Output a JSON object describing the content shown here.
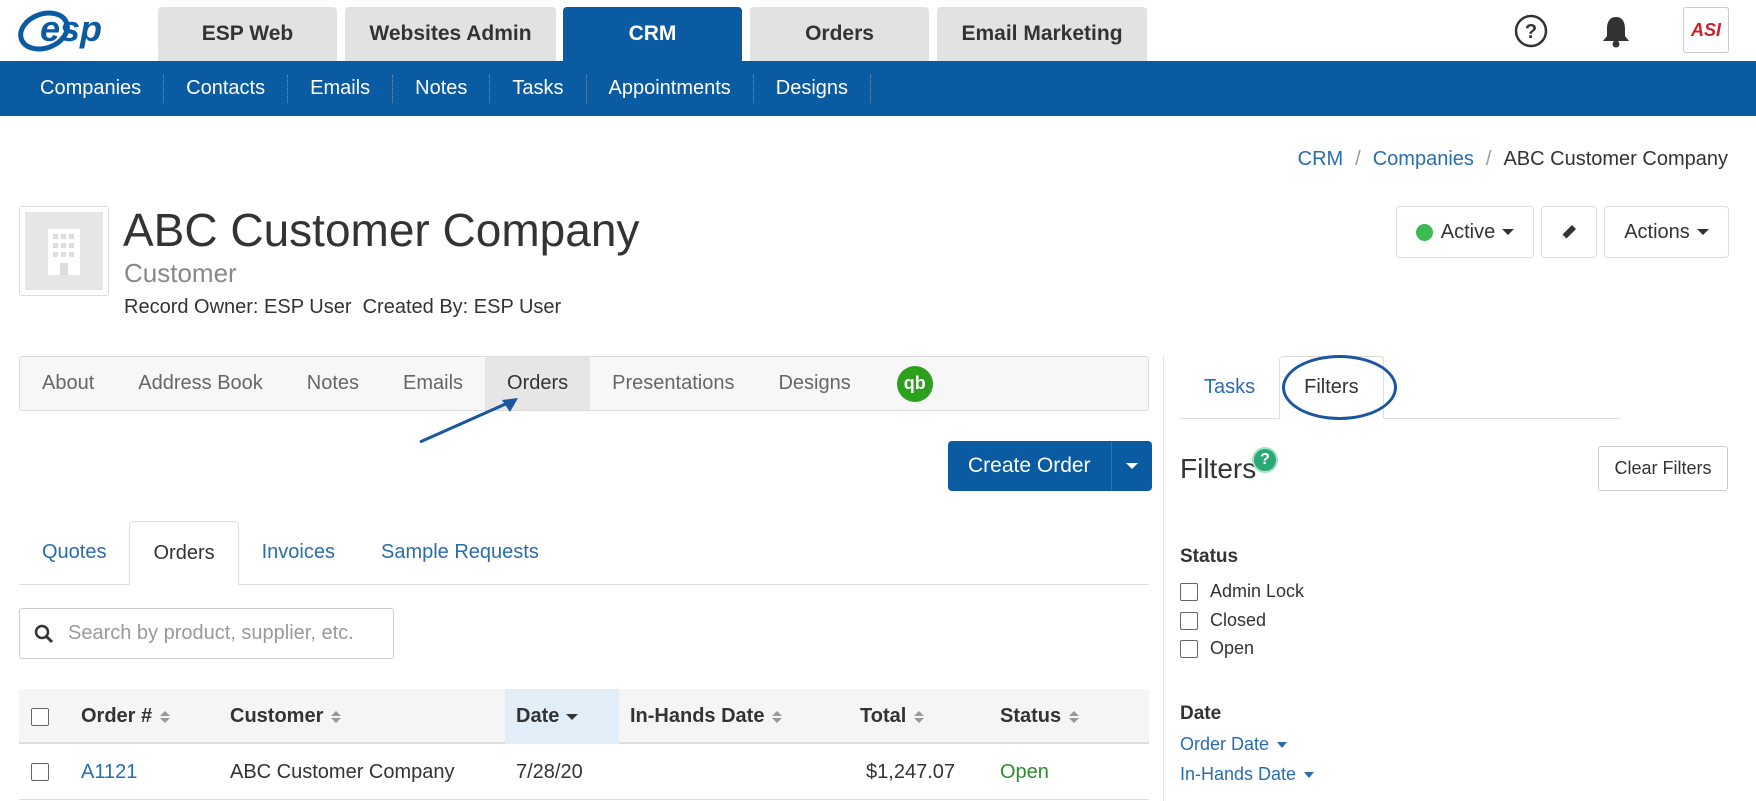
{
  "brand": {
    "logo_text": "esp",
    "accent": "#0a5ba1"
  },
  "app_tabs": [
    {
      "label": "ESP Web",
      "active": false
    },
    {
      "label": "Websites Admin",
      "active": false
    },
    {
      "label": "CRM",
      "active": true
    },
    {
      "label": "Orders",
      "active": false
    },
    {
      "label": "Email Marketing",
      "active": false
    }
  ],
  "top_icons": {
    "help": "help-circle-icon",
    "notifications": "bell-icon",
    "avatar_text": "asi"
  },
  "subnav": [
    "Companies",
    "Contacts",
    "Emails",
    "Notes",
    "Tasks",
    "Appointments",
    "Designs"
  ],
  "breadcrumb": {
    "crm": "CRM",
    "companies": "Companies",
    "current": "ABC Customer Company",
    "sep": "/"
  },
  "company": {
    "name": "ABC Customer Company",
    "type": "Customer",
    "record_info": "Record Owner: ESP User  Created By: ESP User"
  },
  "header_buttons": {
    "status": "Active",
    "status_color": "#3cba54",
    "edit_icon": "pencil-icon",
    "actions": "Actions"
  },
  "record_tabs": [
    {
      "label": "About",
      "active": false
    },
    {
      "label": "Address Book",
      "active": false
    },
    {
      "label": "Notes",
      "active": false
    },
    {
      "label": "Emails",
      "active": false
    },
    {
      "label": "Orders",
      "active": true
    },
    {
      "label": "Presentations",
      "active": false
    },
    {
      "label": "Designs",
      "active": false
    }
  ],
  "qb_icon_text": "qb",
  "create_order": "Create Order",
  "sub_tabs": [
    {
      "label": "Quotes",
      "active": false
    },
    {
      "label": "Orders",
      "active": true
    },
    {
      "label": "Invoices",
      "active": false
    },
    {
      "label": "Sample Requests",
      "active": false
    }
  ],
  "search": {
    "placeholder": "Search by product, supplier, etc.",
    "value": ""
  },
  "table": {
    "headers": {
      "order": "Order #",
      "customer": "Customer",
      "date": "Date",
      "in_hands": "In-Hands Date",
      "total": "Total",
      "status": "Status"
    },
    "rows": [
      {
        "order": "A1121",
        "customer": "ABC Customer Company",
        "date": "7/28/20",
        "in_hands": "",
        "total": "$1,247.07",
        "status": "Open"
      }
    ]
  },
  "side_panel": {
    "tabs": [
      {
        "label": "Tasks",
        "active": false
      },
      {
        "label": "Filters",
        "active": true
      }
    ],
    "title": "Filters",
    "help": "?",
    "clear": "Clear Filters",
    "status_heading": "Status",
    "status_options": [
      "Admin Lock",
      "Closed",
      "Open"
    ],
    "date_heading": "Date",
    "date_links": [
      "Order Date",
      "In-Hands Date"
    ]
  }
}
